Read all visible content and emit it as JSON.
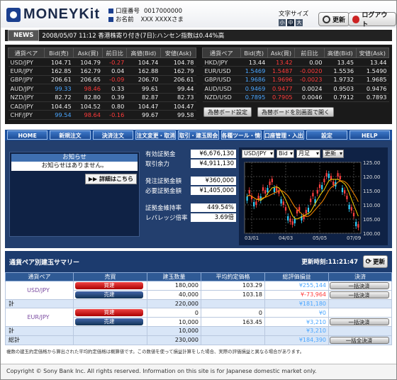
{
  "header": {
    "logo": "MONEYKit",
    "account_label": "口座番号",
    "account_no": "0017000000",
    "name_label": "お名前",
    "name_value": "XXX XXXXさま",
    "font_size_label": "文字サイズ",
    "font_sizes": [
      "小",
      "中",
      "大"
    ],
    "refresh": "更新",
    "logout": "ログアウト"
  },
  "news": {
    "tag": "NEWS",
    "text": "2008/05/07 11:12 香港株寄り付き(7日):ハンセン指数は0.44%高"
  },
  "rates_left": {
    "headers": [
      "通貨ペア",
      "Bid(売)",
      "Ask(買)",
      "前日比",
      "高値(Bid)",
      "安値(Ask)"
    ],
    "rows": [
      [
        "USD/JPY",
        "104.71",
        "104.79",
        "-0.27",
        "104.74",
        "104.78"
      ],
      [
        "EUR/JPY",
        "162.85",
        "162.79",
        "0.04",
        "162.88",
        "162.79"
      ],
      [
        "GBP/JPY",
        "206.61",
        "206.65",
        "-0.09",
        "206.70",
        "206.61"
      ],
      [
        "AUD/JPY",
        "99.33",
        "98.46",
        "0.33",
        "99.61",
        "99.44"
      ],
      [
        "NZD/JPY",
        "82.72",
        "82.80",
        "0.39",
        "82.87",
        "82.73"
      ],
      [
        "CAD/JPY",
        "104.45",
        "104.52",
        "0.80",
        "104.47",
        "104.47"
      ],
      [
        "CHF/JPY",
        "99.54",
        "98.64",
        "-0.16",
        "99.67",
        "99.58"
      ]
    ]
  },
  "rates_right": {
    "headers": [
      "通貨ペア",
      "Bid(売)",
      "Ask(買)",
      "前日比",
      "高値(Bid)",
      "安値(Ask)"
    ],
    "rows": [
      [
        "HKD/JPY",
        "13.44",
        "13.42",
        "0.00",
        "13.45",
        "13.44"
      ],
      [
        "EUR/USD",
        "1.5469",
        "1.5487",
        "-0.0020",
        "1.5536",
        "1.5490"
      ],
      [
        "GBP/USD",
        "1.9686",
        "1.9696",
        "-0.0023",
        "1.9732",
        "1.9685"
      ],
      [
        "AUD/USD",
        "0.9469",
        "0.9477",
        "0.0024",
        "0.9503",
        "0.9476"
      ],
      [
        "NZD/USD",
        "0.7895",
        "0.7905",
        "0.0046",
        "0.7912",
        "0.7893"
      ]
    ],
    "btn_settings": "為替ボード設定",
    "btn_popup": "為替ボードを別画面で開く"
  },
  "nav": [
    "HOME",
    "新規注文",
    "決済注文",
    "注文変更・取消",
    "取引・建玉照会",
    "各種ツール・情報",
    "口座管理・入出金",
    "設定",
    "HELP"
  ],
  "notice": {
    "title": "お知らせ",
    "body": "お知らせはありません。",
    "detail": "詳細はこちら"
  },
  "funds": [
    {
      "label": "有効証拠金",
      "value": "¥6,676,130"
    },
    {
      "label": "取引余力",
      "value": "¥4,911,130"
    },
    {
      "label": "発注証拠金額",
      "value": "¥360,000"
    },
    {
      "label": "必要証拠金額",
      "value": "¥1,405,000"
    },
    {
      "label": "証拠金維持率",
      "value": "449.54%"
    },
    {
      "label": "レバレッジ倍率",
      "value": "3.69倍"
    }
  ],
  "chart_ctrl": {
    "pair": "USD/JPY",
    "side": "Bid",
    "period": "月足",
    "refresh": "更新"
  },
  "chart_data": {
    "type": "line",
    "ylim": [
      100,
      125
    ],
    "yticks": [
      "125.00",
      "120.00",
      "115.00",
      "110.00",
      "105.00",
      "100.00"
    ],
    "xticks": [
      "03/01",
      "04/03",
      "05/05",
      "07/09"
    ]
  },
  "summary": {
    "title": "通貨ペア別建玉サマリー",
    "updated": "更新時刻:11:21:47",
    "refresh": "更新",
    "headers": [
      "通貨ペア",
      "売買",
      "建玉数量",
      "平均約定価格",
      "総評価損益",
      "決済"
    ],
    "usd": {
      "pair": "USD/JPY",
      "buy": "買建",
      "sell": "売建",
      "buy_qty": "180,000",
      "buy_avg": "103.29",
      "buy_pl": "¥255,144",
      "sell_qty": "40,000",
      "sell_avg": "103.18",
      "sell_pl": "¥-73,964",
      "total": "220,000",
      "total_pl": "¥181,180"
    },
    "eur": {
      "pair": "EUR/JPY",
      "buy": "買建",
      "sell": "売建",
      "buy_qty": "0",
      "buy_avg": "0",
      "buy_pl": "¥0",
      "sell_qty": "10,000",
      "sell_avg": "163.45",
      "sell_pl": "¥3,210",
      "total": "10,000",
      "total_pl": "¥3,210"
    },
    "kei": "計",
    "grand_label": "総計",
    "grand_qty": "230,000",
    "grand_pl": "¥184,390",
    "close_btn": "一括決済",
    "close_all": "一括全決済"
  },
  "note": "複数の建玉約定価格から算出された平均約定価格は概算値です。この数値を使って損益計算をした場合、実際の評価損益と異なる場合があります。",
  "footer": "Copyright © Sony Bank Inc. All rights reserved. Information on this site is for Japanese domestic market only."
}
